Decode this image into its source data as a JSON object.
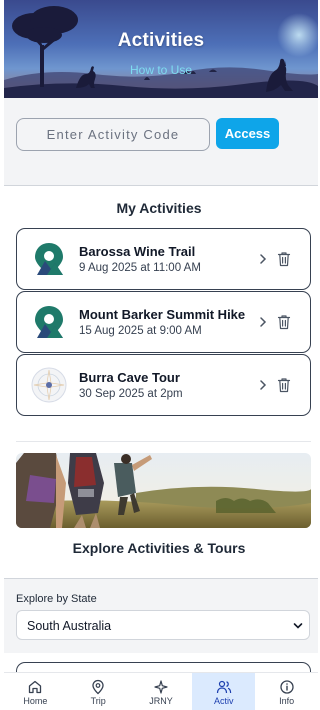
{
  "header": {
    "title": "Activities",
    "subtitle_link": "How to Use"
  },
  "code_entry": {
    "placeholder": "Enter Activity Code",
    "value": "",
    "button_label": "Access"
  },
  "my_activities": {
    "title": "My Activities",
    "items": [
      {
        "name": "Barossa Wine Trail",
        "date": "9 Aug 2025 at 11:00 AM",
        "icon": "map-pin-logo-icon"
      },
      {
        "name": "Mount Barker Summit Hike",
        "date": "15 Aug 2025 at 9:00 AM",
        "icon": "map-pin-logo-icon"
      },
      {
        "name": "Burra Cave Tour",
        "date": "30 Sep 2025 at 2pm",
        "icon": "circle-emblem-icon"
      }
    ]
  },
  "explore": {
    "title": "Explore Activities & Tours",
    "state_label": "Explore by State",
    "state_value": "South Australia"
  },
  "nav": {
    "items": [
      {
        "label": "Home",
        "icon": "home-icon",
        "active": false
      },
      {
        "label": "Trip",
        "icon": "map-pin-icon",
        "active": false
      },
      {
        "label": "JRNY",
        "icon": "sparkle-icon",
        "active": false
      },
      {
        "label": "Activ",
        "icon": "users-icon",
        "active": true
      },
      {
        "label": "Info",
        "icon": "info-icon",
        "active": false
      }
    ]
  },
  "colors": {
    "accent": "#0ea5e9",
    "teal": "#1f7a6a",
    "active_nav_bg": "#dbeafe"
  }
}
